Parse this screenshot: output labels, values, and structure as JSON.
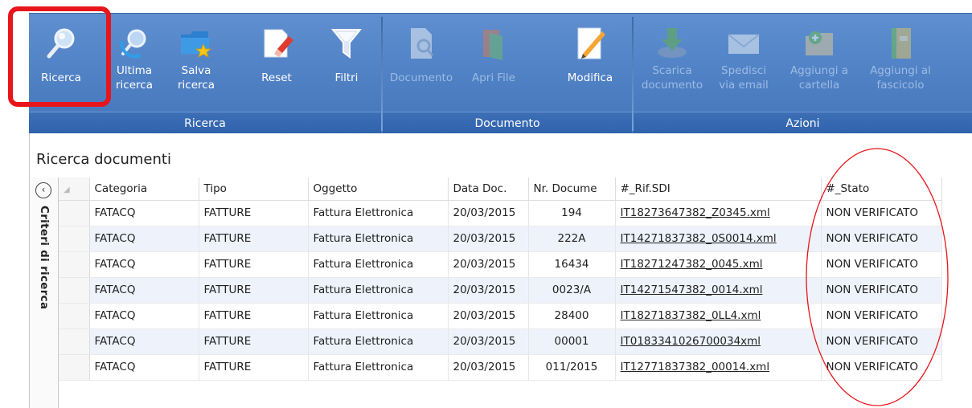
{
  "ribbon": {
    "groups": {
      "ricerca": "Ricerca",
      "documento": "Documento",
      "azioni": "Azioni"
    },
    "buttons": {
      "ricerca": "Ricerca",
      "ultima_ricerca": "Ultima ricerca",
      "salva_ricerca": "Salva ricerca",
      "reset": "Reset",
      "filtri": "Filtri",
      "documento": "Documento",
      "apri_file": "Apri File",
      "modifica": "Modifica",
      "scarica_documento": "Scarica documento",
      "spedisci_email": "Spedisci via email",
      "aggiungi_cartella": "Aggiungi a cartella",
      "aggiungi_fascicolo": "Aggiungi al fascicolo"
    }
  },
  "page": {
    "title": "Ricerca documenti",
    "side_panel_label": "Criteri di ricerca"
  },
  "colors": {
    "ribbon": "#4e7fc3",
    "highlight": "#e8151b"
  },
  "table": {
    "headers": {
      "categoria": "Categoria",
      "tipo": "Tipo",
      "oggetto": "Oggetto",
      "data_doc": "Data Doc.",
      "nr_documento": "Nr. Docume",
      "rif_sdi": "#_Rif.SDI",
      "stato": "#_Stato"
    },
    "rows": [
      {
        "categoria": "FATACQ",
        "tipo": "FATTURE",
        "oggetto": "Fattura Elettronica",
        "data": "20/03/2015",
        "nr": "194",
        "rif": "IT18273647382_Z0345.xml",
        "stato": "NON VERIFICATO"
      },
      {
        "categoria": "FATACQ",
        "tipo": "FATTURE",
        "oggetto": "Fattura Elettronica",
        "data": "20/03/2015",
        "nr": "222A",
        "rif": "IT14271837382_0S0014.xml",
        "stato": "NON VERIFICATO"
      },
      {
        "categoria": "FATACQ",
        "tipo": "FATTURE",
        "oggetto": "Fattura Elettronica",
        "data": "20/03/2015",
        "nr": "16434",
        "rif": "IT18271247382_0045.xml",
        "stato": "NON VERIFICATO"
      },
      {
        "categoria": "FATACQ",
        "tipo": "FATTURE",
        "oggetto": "Fattura Elettronica",
        "data": "20/03/2015",
        "nr": "0023/A",
        "rif": "IT14271547382_0014.xml",
        "stato": "NON VERIFICATO"
      },
      {
        "categoria": "FATACQ",
        "tipo": "FATTURE",
        "oggetto": "Fattura Elettronica",
        "data": "20/03/2015",
        "nr": "28400",
        "rif": "IT18271837382_0LL4.xml",
        "stato": "NON VERIFICATO"
      },
      {
        "categoria": "FATACQ",
        "tipo": "FATTURE",
        "oggetto": "Fattura Elettronica",
        "data": "20/03/2015",
        "nr": "00001",
        "rif": "IT0183341026700034xml",
        "stato": "NON VERIFICATO"
      },
      {
        "categoria": "FATACQ",
        "tipo": "FATTURE",
        "oggetto": "Fattura Elettronica",
        "data": "20/03/2015",
        "nr": "011/2015",
        "rif": "IT12771837382_00014.xml",
        "stato": "NON VERIFICATO"
      }
    ]
  }
}
